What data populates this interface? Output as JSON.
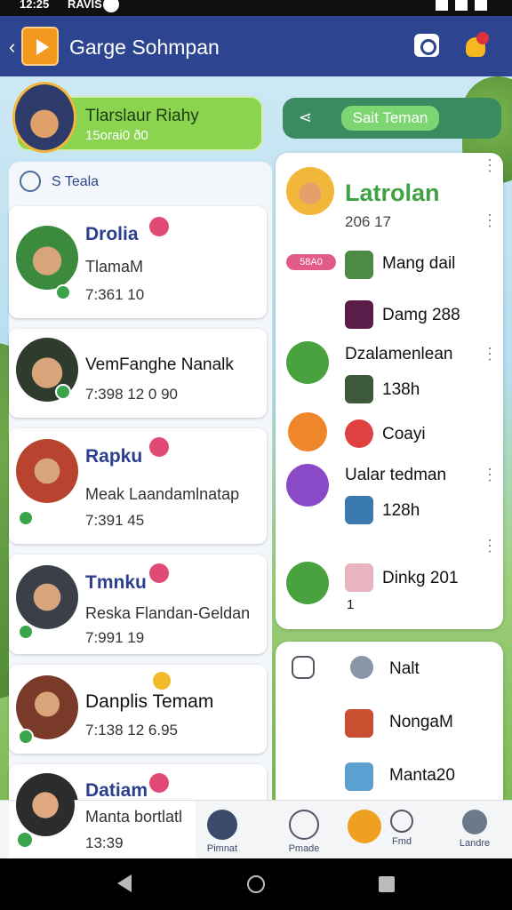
{
  "status": {
    "time": "12:25",
    "signal": "RAVIS"
  },
  "app_bar": {
    "title": "Garge Sohmpan"
  },
  "profile": {
    "name": "Tlarslaur Riahy",
    "sub": "15orai0 ð0"
  },
  "invite": {
    "button_label": "Sait Teman"
  },
  "search": {
    "text": "S  Teala"
  },
  "chats": [
    {
      "name": "Drolia",
      "message": "TlamaM",
      "time": "7:361 10"
    },
    {
      "name": "VemFanghe Nanalk",
      "message": "",
      "time": "7:398 12 0 90"
    },
    {
      "name": "Rapku",
      "message": "Meak Laandamlnatap",
      "time": "7:391 45"
    },
    {
      "name": "Tmnku",
      "message": "Reska Flandan-Geldan",
      "time": "7:991 19"
    },
    {
      "name": "Danplis Temam",
      "message": "",
      "time": "7:138 12 6.95"
    },
    {
      "name": "Datiam",
      "message": "Manta bortlatl",
      "time": "13:39"
    }
  ],
  "group_panel": {
    "title": "Latrolan",
    "subtitle": "206 17",
    "tag": "58A0",
    "items": [
      {
        "label": "Mang dail"
      },
      {
        "label": "Damg 288"
      },
      {
        "label": "Dzalamenlean"
      },
      {
        "label": "138h"
      },
      {
        "label": "Coayi"
      },
      {
        "label": "Ualar tedman"
      },
      {
        "label": "128h"
      },
      {
        "label": "Dinkg 201"
      },
      {
        "label": "1"
      }
    ]
  },
  "bottom_panel": {
    "items": [
      {
        "label": "Nalt"
      },
      {
        "label": "NongaM"
      },
      {
        "label": "Manta20"
      }
    ]
  },
  "nav": {
    "items": [
      {
        "label": "Pimnat"
      },
      {
        "label": "Pmade"
      },
      {
        "label": ""
      },
      {
        "label": "Fmd"
      },
      {
        "label": "Landre"
      }
    ]
  },
  "colors": {
    "app_bar": "#2d4590",
    "accent_green": "#3fa243",
    "badge_pink": "#e04a74"
  }
}
